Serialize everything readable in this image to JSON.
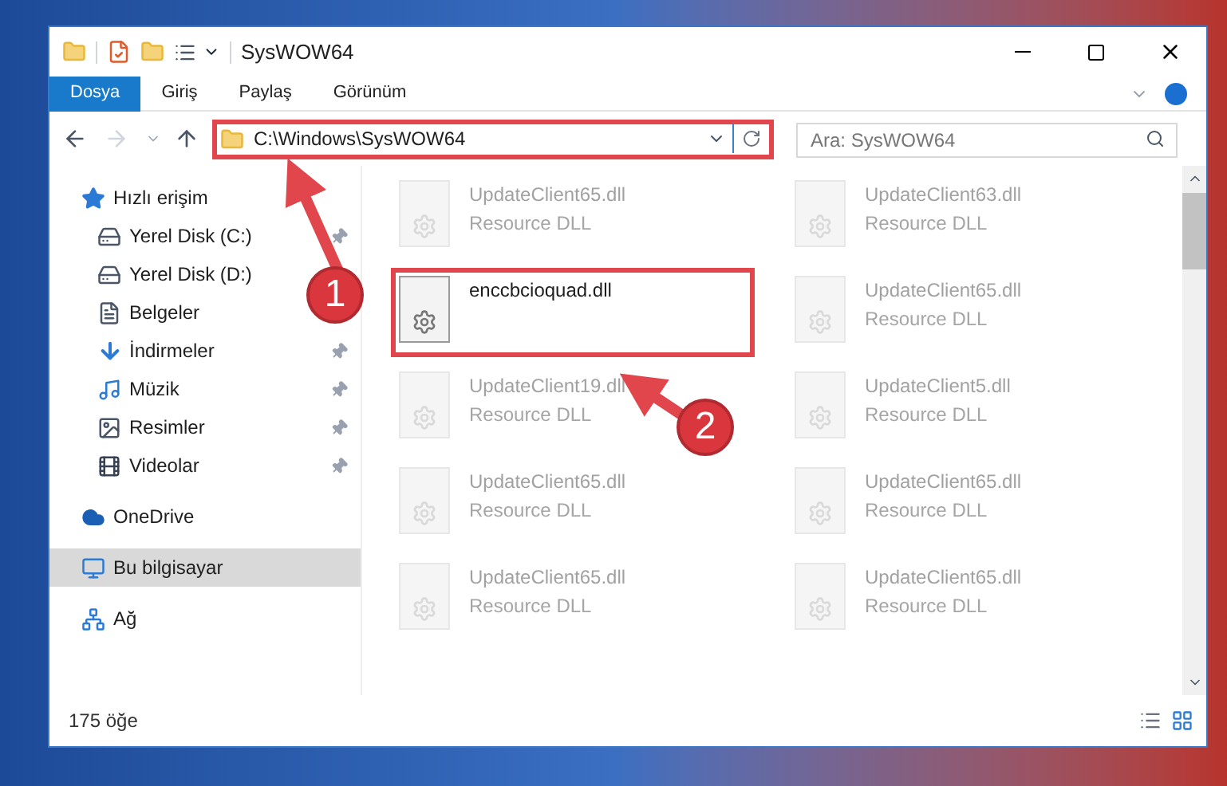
{
  "window": {
    "title": "SysWOW64"
  },
  "ribbon_tabs": [
    {
      "label": "Dosya",
      "selected": true
    },
    {
      "label": "Giriş",
      "selected": false
    },
    {
      "label": "Paylaş",
      "selected": false
    },
    {
      "label": "Görünüm",
      "selected": false
    }
  ],
  "address_bar": {
    "path": "C:\\Windows\\SysWOW64",
    "highlighted": true
  },
  "search": {
    "placeholder": "Ara: SysWOW64"
  },
  "sidebar": {
    "items": [
      {
        "label": "Hızlı erişim",
        "kind": "star",
        "selected": false,
        "children": [
          {
            "label": "Yerel Disk (C:)",
            "kind": "drive",
            "pinned": true,
            "selected": false
          },
          {
            "label": "Yerel Disk (D:)",
            "kind": "drive",
            "pinned": false,
            "selected": false
          },
          {
            "label": "Belgeler",
            "kind": "documents",
            "pinned": false,
            "selected": false
          },
          {
            "label": "İndirmeler",
            "kind": "downloads",
            "pinned": true,
            "selected": false
          },
          {
            "label": "Müzik",
            "kind": "music",
            "pinned": true,
            "selected": false
          },
          {
            "label": "Resimler",
            "kind": "pictures",
            "pinned": true,
            "selected": false
          },
          {
            "label": "Videolar",
            "kind": "videos",
            "pinned": true,
            "selected": false
          }
        ]
      },
      {
        "label": "OneDrive",
        "kind": "cloud",
        "selected": false
      },
      {
        "label": "Bu bilgisayar",
        "kind": "computer",
        "selected": true
      },
      {
        "label": "Ağ",
        "kind": "network",
        "selected": false
      }
    ]
  },
  "files": [
    {
      "name": "UpdateClient65.dll",
      "type": "Resource DLL",
      "blurred": true,
      "highlighted": false
    },
    {
      "name": "UpdateClient63.dll",
      "type": "Resource DLL",
      "blurred": true,
      "highlighted": false
    },
    {
      "name": "enccbcioquad.dll",
      "blurred": false,
      "highlighted": true
    },
    {
      "name": "UpdateClient65.dll",
      "type": "Resource DLL",
      "blurred": true,
      "highlighted": false
    },
    {
      "name": "UpdateClient19.dll",
      "type": "Resource DLL",
      "blurred": true,
      "highlighted": false
    },
    {
      "name": "UpdateClient5.dll",
      "type": "Resource DLL",
      "blurred": true,
      "highlighted": false
    },
    {
      "name": "UpdateClient65.dll",
      "type": "Resource DLL",
      "blurred": true,
      "highlighted": false
    },
    {
      "name": "UpdateClient65.dll",
      "type": "Resource DLL",
      "blurred": true,
      "highlighted": false
    },
    {
      "name": "UpdateClient65.dll",
      "type": "Resource DLL",
      "blurred": true,
      "highlighted": false
    },
    {
      "name": "UpdateClient65.dll",
      "type": "Resource DLL",
      "blurred": true,
      "highlighted": false
    }
  ],
  "status_bar": {
    "item_count": "175 öğe"
  },
  "callouts": [
    {
      "number": "1"
    },
    {
      "number": "2"
    }
  ]
}
